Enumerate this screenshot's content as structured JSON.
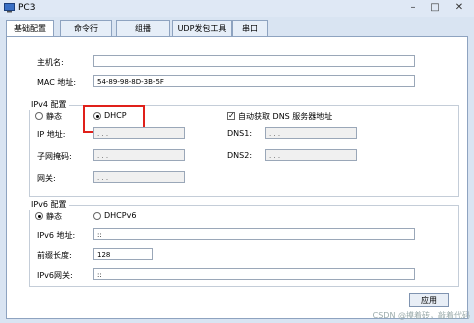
{
  "window": {
    "title": "PC3"
  },
  "tabs": [
    {
      "label": "基础配置"
    },
    {
      "label": "命令行"
    },
    {
      "label": "组播"
    },
    {
      "label": "UDP发包工具"
    },
    {
      "label": "串口"
    }
  ],
  "basic": {
    "hostname_label": "主机名:",
    "hostname_value": "",
    "mac_label": "MAC 地址:",
    "mac_value": "54-89-98-8D-3B-5F"
  },
  "ipv4": {
    "group_title": "IPv4 配置",
    "static_label": "静态",
    "dhcp_label": "DHCP",
    "mode": "DHCP",
    "auto_dns_label": "自动获取 DNS 服务器地址",
    "auto_dns_checked": true,
    "ip_label": "IP 地址:",
    "mask_label": "子网掩码:",
    "gateway_label": "网关:",
    "dns1_label": "DNS1:",
    "dns2_label": "DNS2:",
    "ip_placeholder": ".      .      ."
  },
  "ipv6": {
    "group_title": "IPv6 配置",
    "static_label": "静态",
    "dhcpv6_label": "DHCPv6",
    "mode": "静态",
    "addr_label": "IPv6 地址:",
    "addr_value": "::",
    "prefix_label": "前缀长度:",
    "prefix_value": "128",
    "gateway_label": "IPv6网关:",
    "gateway_value": "::"
  },
  "apply_label": "应用",
  "watermark": "CSDN @摸着砖，敲着代码"
}
